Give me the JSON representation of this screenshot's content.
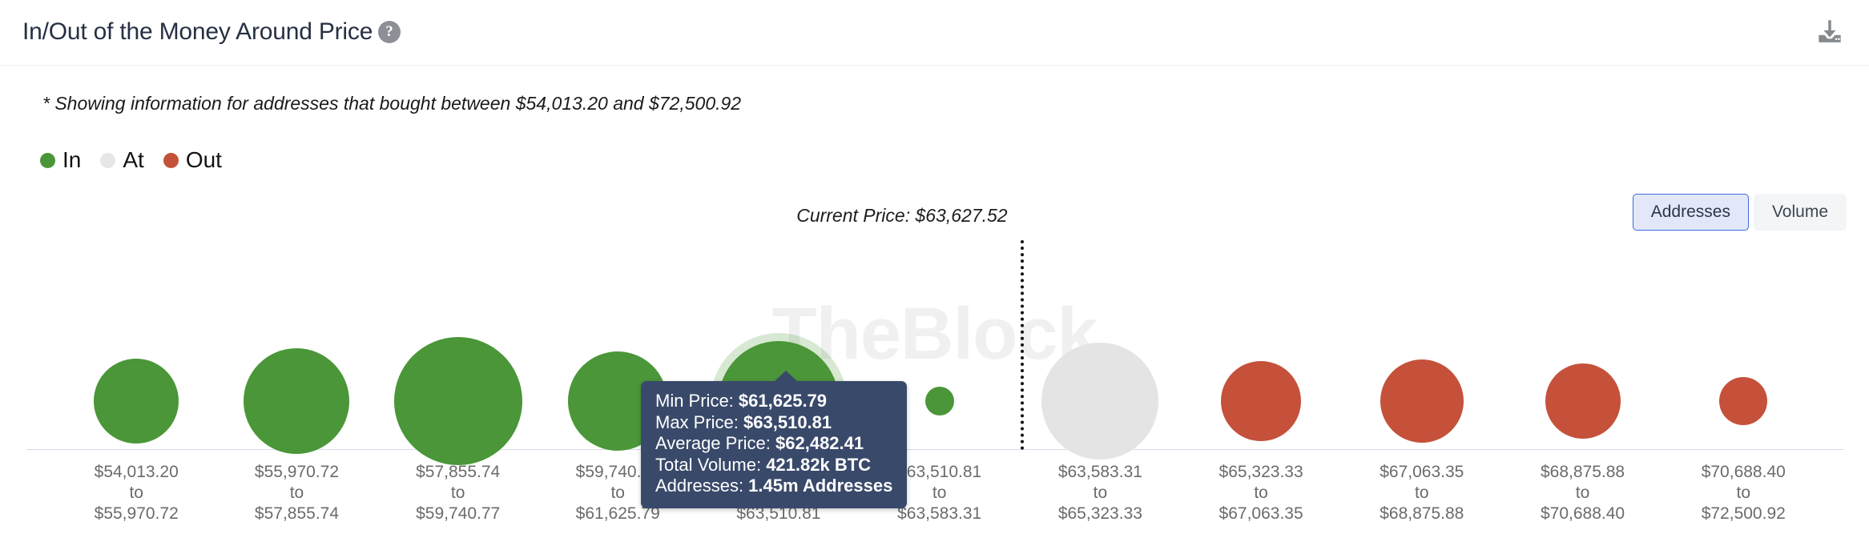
{
  "header": {
    "title": "In/Out of the Money Around Price",
    "help_icon": "question-mark-icon",
    "download_icon": "download-icon"
  },
  "subtitle": "* Showing information for addresses that bought between $54,013.20 and $72,500.92",
  "legend": {
    "items": [
      {
        "label": "In",
        "color": "#4a9638"
      },
      {
        "label": "At",
        "color": "#e6e6e6"
      },
      {
        "label": "Out",
        "color": "#c5513a"
      }
    ]
  },
  "toggle": {
    "options": [
      {
        "label": "Addresses",
        "selected": true
      },
      {
        "label": "Volume",
        "selected": false
      }
    ]
  },
  "current_price": {
    "label": "Current Price: $63,627.52",
    "value": "$63,627.52"
  },
  "watermark": "TheBlock",
  "tooltip": {
    "rows": [
      {
        "key": "Min Price: ",
        "value": "$61,625.79"
      },
      {
        "key": "Max Price: ",
        "value": "$63,510.81"
      },
      {
        "key": "Average Price: ",
        "value": "$62,482.41"
      },
      {
        "key": "Total Volume: ",
        "value": "421.82k BTC"
      },
      {
        "key": "Addresses: ",
        "value": "1.45m Addresses"
      }
    ]
  },
  "colors": {
    "in": "#4a9638",
    "at": "#e4e4e4",
    "out": "#c5513a",
    "tooltip_bg": "#39496a",
    "accent": "#3e6ae1",
    "axis": "#d5dae6"
  },
  "chart_data": {
    "type": "scatter",
    "title": "In/Out of the Money Around Price",
    "subtitle": "* Showing information for addresses that bought between $54,013.20 and $72,500.92",
    "xlabel": "",
    "ylabel": "",
    "metric": "Addresses",
    "legend_position": "top-left",
    "grid": false,
    "annotations": [
      "Current Price: $63,627.52"
    ],
    "categories": [
      "$54,013.20 to $55,970.72",
      "$55,970.72 to $57,855.74",
      "$57,855.74 to $59,740.77",
      "$59,740.77 to $61,625.79",
      "$61,625.79 to $63,510.81",
      "$63,510.81 to $63,583.31",
      "$63,583.31 to $65,323.33",
      "$65,323.33 to $67,063.35",
      "$67,063.35 to $68,875.88",
      "$68,875.88 to $70,688.40",
      "$70,688.40 to $72,500.92"
    ],
    "points": [
      {
        "label": "$54,013.20\nto\n$55,970.72",
        "x_pct": 6.05,
        "radius": 53,
        "state": "In",
        "color": "#4a9638"
      },
      {
        "label": "$55,970.72\nto\n$57,855.74",
        "x_pct": 14.88,
        "radius": 66,
        "state": "In",
        "color": "#4a9638"
      },
      {
        "label": "$57,855.74\nto\n$59,740.77",
        "x_pct": 23.75,
        "radius": 80,
        "state": "In",
        "color": "#4a9638"
      },
      {
        "label": "$59,740.77\nto\n$61,625.79",
        "x_pct": 32.55,
        "radius": 62,
        "state": "In",
        "color": "#4a9638"
      },
      {
        "label": "$61,625.79\nto\n$63,510.81",
        "x_pct": 41.4,
        "radius": 75,
        "state": "In",
        "color": "#4a9638",
        "highlighted": true
      },
      {
        "label": "$63,510.81\nto\n$63,583.31",
        "x_pct": 50.25,
        "radius": 18,
        "state": "In",
        "color": "#4a9638"
      },
      {
        "label": "$63,583.31\nto\n$65,323.33",
        "x_pct": 59.1,
        "radius": 73,
        "state": "At",
        "color": "#e4e4e4"
      },
      {
        "label": "$65,323.33\nto\n$67,063.35",
        "x_pct": 67.95,
        "radius": 50,
        "state": "Out",
        "color": "#c5513a"
      },
      {
        "label": "$67,063.35\nto\n$68,875.88",
        "x_pct": 76.8,
        "radius": 52,
        "state": "Out",
        "color": "#c5513a"
      },
      {
        "label": "$68,875.88\nto\n$70,688.40",
        "x_pct": 85.65,
        "radius": 47,
        "state": "Out",
        "color": "#c5513a"
      },
      {
        "label": "$70,688.40\nto\n$72,500.92",
        "x_pct": 94.5,
        "radius": 30,
        "state": "Out",
        "color": "#c5513a"
      }
    ],
    "current_price_marker": {
      "value": 63627.52,
      "x_pct": 54.7,
      "label": "Current Price: $63,627.52"
    },
    "hovered_point": {
      "index": 4,
      "min_price": "$61,625.79",
      "max_price": "$63,510.81",
      "average_price": "$62,482.41",
      "total_volume": "421.82k BTC",
      "addresses": "1.45m Addresses"
    }
  },
  "xaxis_labels": [
    {
      "line1": "$54,013.20",
      "line2": "to",
      "line3": "$55,970.72",
      "x_pct": 6.05
    },
    {
      "line1": "$55,970.72",
      "line2": "to",
      "line3": "$57,855.74",
      "x_pct": 14.88
    },
    {
      "line1": "$57,855.74",
      "line2": "to",
      "line3": "$59,740.77",
      "x_pct": 23.75
    },
    {
      "line1": "$59,740.77",
      "line2": "to",
      "line3": "$61,625.79",
      "x_pct": 32.55
    },
    {
      "line1": "$61,625.79",
      "line2": "to",
      "line3": "$63,510.81",
      "x_pct": 41.4
    },
    {
      "line1": "$63,510.81",
      "line2": "to",
      "line3": "$63,583.31",
      "x_pct": 50.25
    },
    {
      "line1": "$63,583.31",
      "line2": "to",
      "line3": "$65,323.33",
      "x_pct": 59.1
    },
    {
      "line1": "$65,323.33",
      "line2": "to",
      "line3": "$67,063.35",
      "x_pct": 67.95
    },
    {
      "line1": "$67,063.35",
      "line2": "to",
      "line3": "$68,875.88",
      "x_pct": 76.8
    },
    {
      "line1": "$68,875.88",
      "line2": "to",
      "line3": "$70,688.40",
      "x_pct": 85.65
    },
    {
      "line1": "$70,688.40",
      "line2": "to",
      "line3": "$72,500.92",
      "x_pct": 94.5
    }
  ]
}
